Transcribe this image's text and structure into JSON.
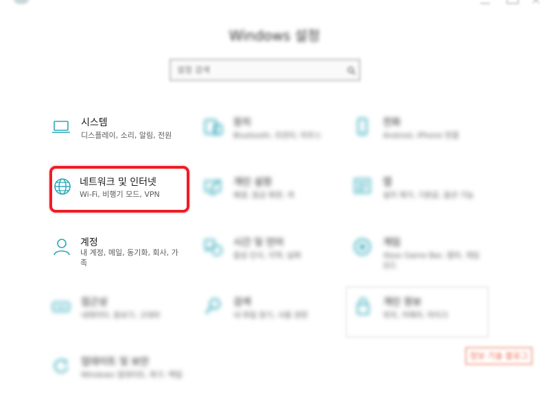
{
  "window": {
    "title": "Windows 설정"
  },
  "search": {
    "placeholder": "설정 검색"
  },
  "tiles": [
    {
      "name": "시스템",
      "desc": "디스플레이, 소리, 알림, 전원",
      "icon": "laptop-icon"
    },
    {
      "name": "장치",
      "desc": "Bluetooth, 프린터, 마우스",
      "icon": "devices-icon"
    },
    {
      "name": "전화",
      "desc": "Android, iPhone 연결",
      "icon": "phone-icon"
    },
    {
      "name": "네트워크 및 인터넷",
      "desc": "Wi-Fi, 비행기 모드, VPN",
      "icon": "globe-icon"
    },
    {
      "name": "개인 설정",
      "desc": "배경, 잠금 화면, 색",
      "icon": "personalization-icon"
    },
    {
      "name": "앱",
      "desc": "설치 제거, 기본값, 옵션 기능",
      "icon": "apps-icon"
    },
    {
      "name": "계정",
      "desc": "내 계정, 메일, 동기화, 회사, 가족",
      "icon": "account-icon"
    },
    {
      "name": "시간 및 언어",
      "desc": "음성 인식, 지역, 날짜",
      "icon": "time-language-icon"
    },
    {
      "name": "게임",
      "desc": "Xbox Game Bar, 캡처, 게임 모드",
      "icon": "gaming-icon"
    },
    {
      "name": "접근성",
      "desc": "내레이터, 돋보기, 고대비",
      "icon": "accessibility-icon"
    },
    {
      "name": "검색",
      "desc": "내 파일 찾기, 사용 권한",
      "icon": "search-settings-icon"
    },
    {
      "name": "개인 정보",
      "desc": "위치, 카메라, 마이크",
      "icon": "privacy-icon"
    },
    {
      "name": "업데이트 및 보안",
      "desc": "Windows 업데이트, 복구, 백업",
      "icon": "update-security-icon"
    }
  ],
  "stamp": {
    "text": "정보 기술 블로그"
  },
  "colors": {
    "accent": "#2aa7b8",
    "highlight": "#ee1c25"
  }
}
